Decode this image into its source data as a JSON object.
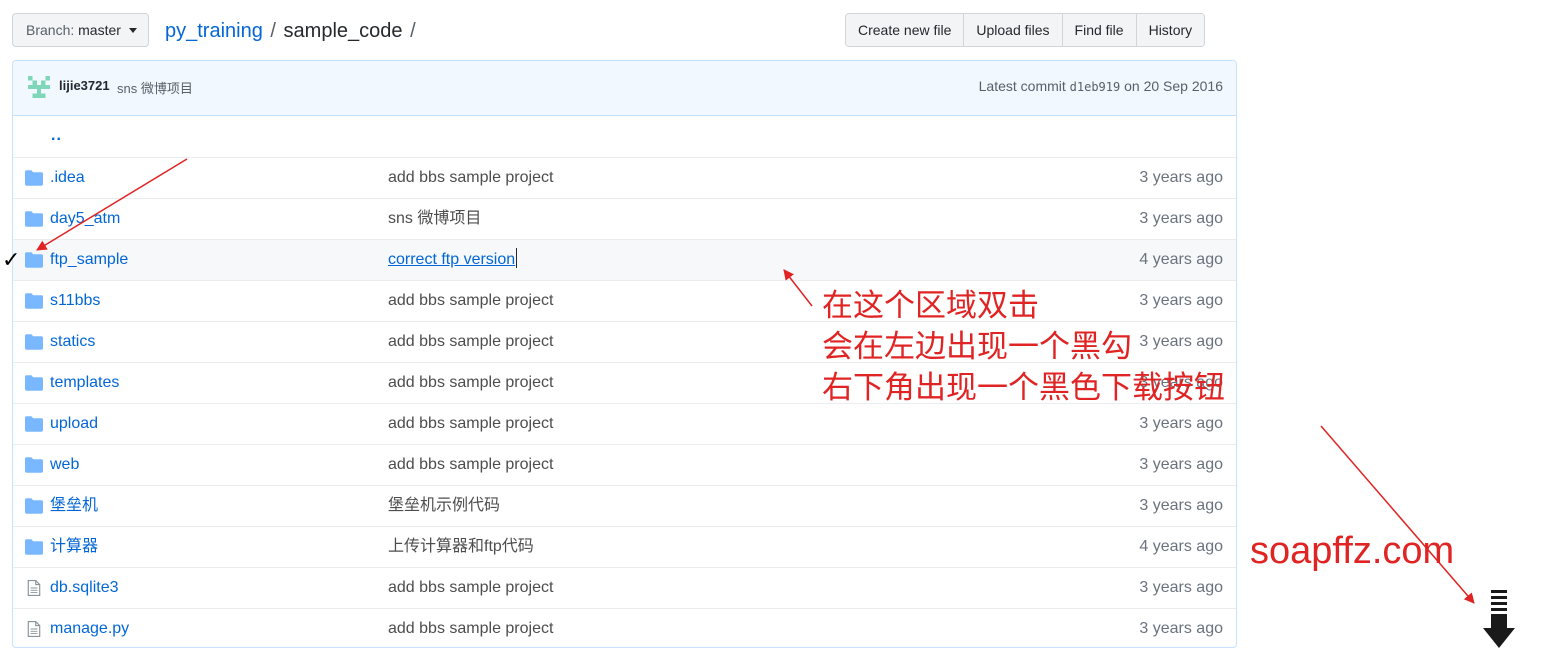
{
  "toolbar": {
    "branch_label": "Branch:",
    "branch_value": "master",
    "repo": "py_training",
    "sep": "/",
    "dir": "sample_code",
    "trailing_sep": "/",
    "buttons": [
      "Create new file",
      "Upload files",
      "Find file",
      "History"
    ]
  },
  "commit": {
    "user": "lijie3721",
    "message": "sns 微博项目",
    "prefix": "Latest commit",
    "sha": "d1eb919",
    "date": "on 20 Sep 2016"
  },
  "files": [
    {
      "name": "..",
      "type": "up",
      "message": "",
      "age": ""
    },
    {
      "name": ".idea",
      "type": "folder",
      "message": "add bbs sample project",
      "age": "3 years ago"
    },
    {
      "name": "day5_atm",
      "type": "folder",
      "message": "sns 微博项目",
      "age": "3 years ago"
    },
    {
      "name": "ftp_sample",
      "type": "folder",
      "message": "correct ftp version",
      "age": "4 years ago"
    },
    {
      "name": "s11bbs",
      "type": "folder",
      "message": "add bbs sample project",
      "age": "3 years ago"
    },
    {
      "name": "statics",
      "type": "folder",
      "message": "add bbs sample project",
      "age": "3 years ago"
    },
    {
      "name": "templates",
      "type": "folder",
      "message": "add bbs sample project",
      "age": "3 years ago"
    },
    {
      "name": "upload",
      "type": "folder",
      "message": "add bbs sample project",
      "age": "3 years ago"
    },
    {
      "name": "web",
      "type": "folder",
      "message": "add bbs sample project",
      "age": "3 years ago"
    },
    {
      "name": "堡垒机",
      "type": "folder",
      "message": "堡垒机示例代码",
      "age": "3 years ago"
    },
    {
      "name": "计算器",
      "type": "folder",
      "message": "上传计算器和ftp代码",
      "age": "4 years ago"
    },
    {
      "name": "db.sqlite3",
      "type": "file",
      "message": "add bbs sample project",
      "age": "3 years ago"
    },
    {
      "name": "manage.py",
      "type": "file",
      "message": "add bbs sample project",
      "age": "3 years ago"
    }
  ],
  "selection": {
    "check_mark": "✓",
    "row_index": 3
  },
  "annotation": {
    "lines": [
      "在这个区域双击",
      "会在左边出现一个黑勾",
      "右下角出现一个黑色下载按钮"
    ]
  },
  "watermark": "soapffz.com",
  "colors": {
    "link": "#0366d6",
    "folder_icon": "#79b8ff",
    "annotation_red": "#e02424",
    "commit_bar_bg": "#f1f8ff",
    "border": "#c8e1ff"
  },
  "icons": {
    "folder": "folder-icon",
    "file": "file-icon",
    "download": "download-arrow-icon",
    "caret": "caret-down-icon",
    "avatar": "identicon-avatar"
  }
}
